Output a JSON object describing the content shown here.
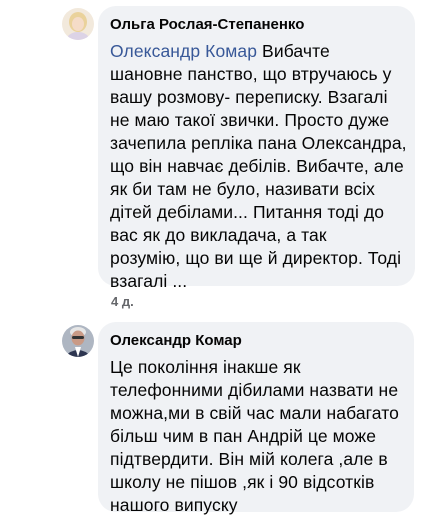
{
  "comments": [
    {
      "author": "Ольга Рослая-Степаненко",
      "mention": "Олександр Комар",
      "first_line_rest": " Вибачте",
      "lines": [
        "шановне панство, що втручаюсь у",
        "вашу розмову- переписку.  Взагалі",
        "не маю такої звички. Просто дуже",
        "зачепила репліка пана Олександра,",
        "що він навчає дебілів. Вибачте, але",
        "як би там не було, називати всіх",
        "дітей дебілами... Питання тоді до",
        "вас як до викладача, а так",
        "розумію, що ви ще й директор. Тоді",
        "взагалі ..."
      ],
      "timestamp": "4 д."
    },
    {
      "author": "Олександр Комар",
      "lines": [
        "Це покоління інакше як",
        "телефонними дібилами назвати не",
        "можна,ми в свій час мали набагато",
        "більш чим в пан Андрій це може",
        "підтвердити. Він мій колега ,але в",
        "школу не пішов ,як і 90 відсотків",
        "нашого випуску"
      ]
    }
  ]
}
